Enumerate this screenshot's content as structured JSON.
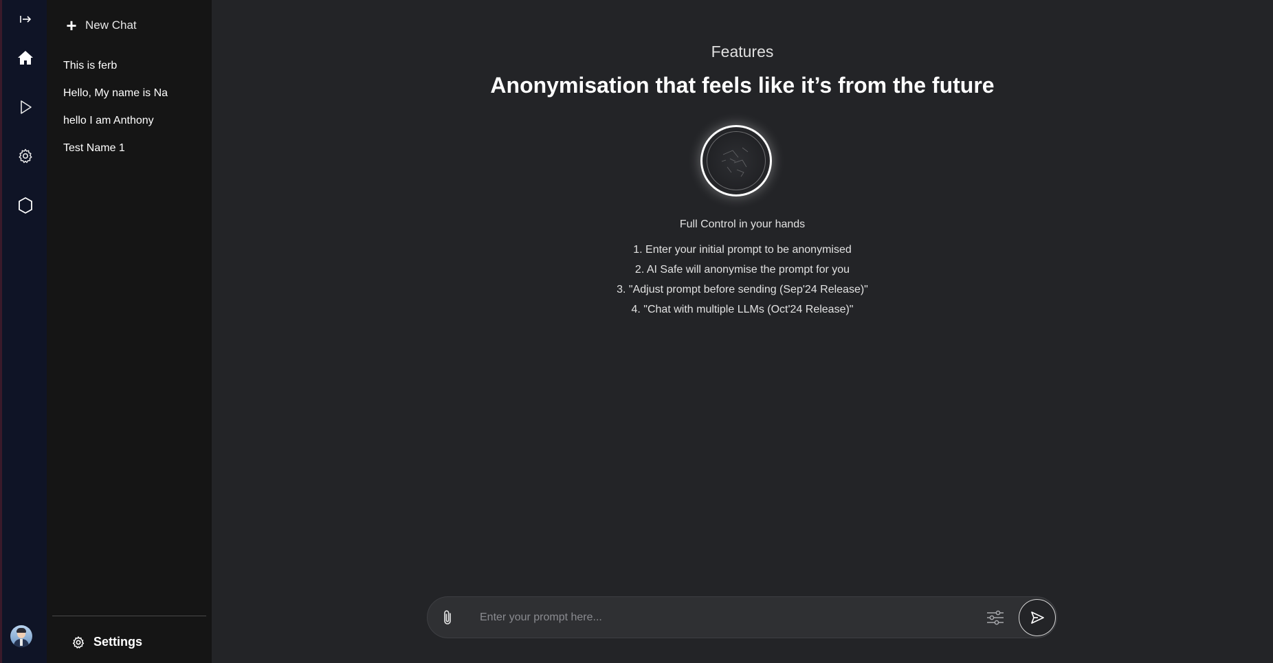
{
  "rail": {
    "items": [
      {
        "icon": "collapse-sidebar-icon"
      },
      {
        "icon": "home-icon"
      },
      {
        "icon": "play-icon"
      },
      {
        "icon": "gear-icon"
      },
      {
        "icon": "hexagon-icon"
      }
    ],
    "avatar": "avatar"
  },
  "sidebar": {
    "new_chat_label": "New Chat",
    "history": [
      {
        "label": "This is ferb"
      },
      {
        "label": "Hello, My name is Na"
      },
      {
        "label": "hello I am Anthony"
      },
      {
        "label": "Test Name 1"
      }
    ],
    "settings_label": "Settings"
  },
  "main": {
    "eyebrow": "Features",
    "headline": "Anonymisation that feels like it’s from the future",
    "subtitle": "Full Control in your hands",
    "steps": [
      {
        "label": "1. Enter your initial prompt to be anonymised"
      },
      {
        "label": "2. AI Safe will anonymise the prompt for you"
      },
      {
        "label": "3. \"Adjust prompt before sending (Sep'24 Release)\""
      },
      {
        "label": "4. \"Chat with multiple LLMs (Oct'24 Release)\""
      }
    ]
  },
  "prompt": {
    "placeholder": "Enter your prompt here...",
    "value": ""
  },
  "colors": {
    "rail_bg": "#0f1426",
    "sidebar_bg": "#151515",
    "main_bg": "#232427",
    "prompt_bg": "#2f3033"
  }
}
